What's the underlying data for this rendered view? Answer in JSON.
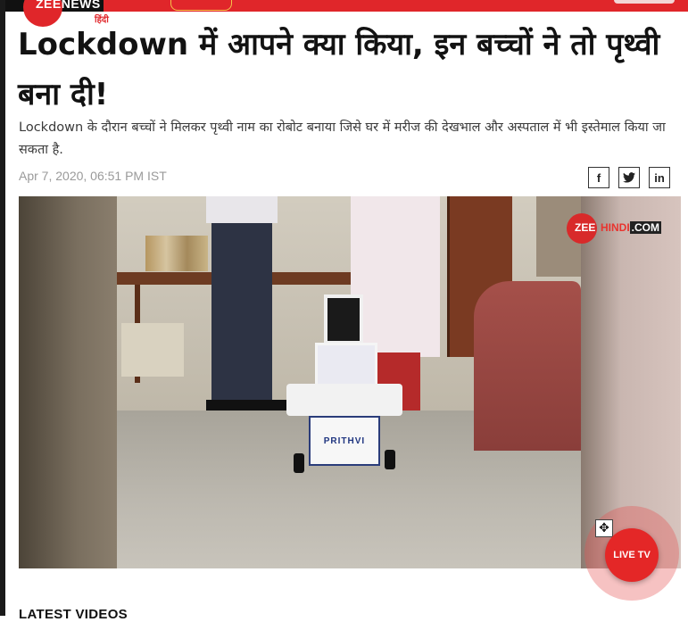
{
  "header": {
    "logo_text": "ZEENEWS",
    "logo_subtext": "हिंदी"
  },
  "article": {
    "headline": "Lockdown में आपने क्या किया, इन बच्चों ने तो पृथ्वी बना दी!",
    "summary": "Lockdown के दौरान बच्चों ने मिलकर पृथ्वी नाम का रोबोट बनाया जिसे घर में मरीज की देखभाल और अस्पताल में भी इस्तेमाल किया जा सकता है.",
    "date": "Apr 7, 2020, 06:51 PM IST"
  },
  "share": {
    "facebook": "f",
    "twitter": "t",
    "linkedin": "in"
  },
  "video": {
    "watermark_zee": "ZEE",
    "watermark_hindi": "HINDI",
    "watermark_dotcom": ".COM",
    "robot_label": "PRITHVI"
  },
  "live_tv": {
    "label": "LIVE TV"
  },
  "latest_videos": {
    "heading": "LATEST VIDEOS"
  },
  "icons": {
    "move": "move-icon",
    "facebook": "facebook-icon",
    "twitter": "twitter-icon",
    "linkedin": "linkedin-icon"
  },
  "colors": {
    "brand_red": "#e0262a",
    "live_red": "#e42727"
  }
}
